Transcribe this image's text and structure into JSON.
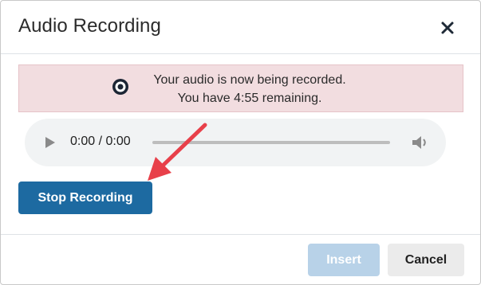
{
  "dialog": {
    "title": "Audio Recording",
    "close_icon": "close-icon"
  },
  "alert": {
    "icon": "record-icon",
    "line1": "Your audio is now being recorded.",
    "line2": "You have 4:55 remaining.",
    "background": "#f2dde0"
  },
  "player": {
    "play_icon": "play-icon",
    "time": "0:00 / 0:00",
    "volume_icon": "volume-icon",
    "progress": 0
  },
  "actions": {
    "stop_label": "Stop Recording",
    "stop_color": "#1d6aa1"
  },
  "annotation": {
    "arrow_icon": "arrow-icon",
    "color": "#e8404a"
  },
  "footer": {
    "insert_label": "Insert",
    "cancel_label": "Cancel"
  }
}
